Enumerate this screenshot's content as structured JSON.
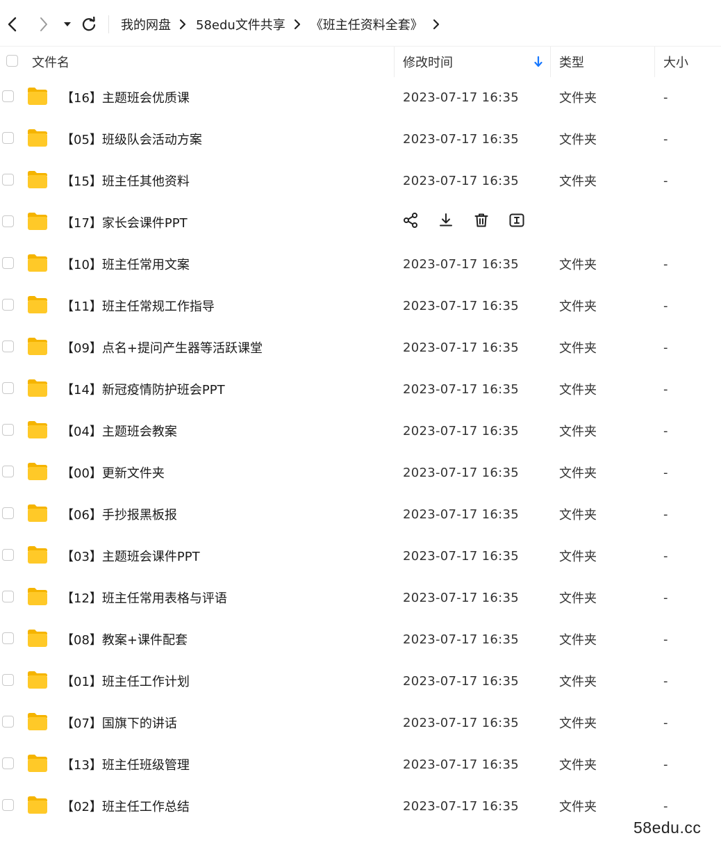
{
  "nav": {
    "breadcrumb": [
      "我的网盘",
      "58edu文件共享",
      "《班主任资料全套》"
    ]
  },
  "table": {
    "columns": {
      "name": "文件名",
      "mtime": "修改时间",
      "type": "类型",
      "size": "大小"
    },
    "rows": [
      {
        "name": "【16】主题班会优质课",
        "mtime": "2023-07-17 16:35",
        "type": "文件夹",
        "size": "-"
      },
      {
        "name": "【05】班级队会活动方案",
        "mtime": "2023-07-17 16:35",
        "type": "文件夹",
        "size": "-"
      },
      {
        "name": "【15】班主任其他资料",
        "mtime": "2023-07-17 16:35",
        "type": "文件夹",
        "size": "-"
      },
      {
        "name": "【17】家长会课件PPT",
        "mtime": "",
        "type": "",
        "size": "",
        "hovered": true
      },
      {
        "name": "【10】班主任常用文案",
        "mtime": "2023-07-17 16:35",
        "type": "文件夹",
        "size": "-"
      },
      {
        "name": "【11】班主任常规工作指导",
        "mtime": "2023-07-17 16:35",
        "type": "文件夹",
        "size": "-"
      },
      {
        "name": "【09】点名+提问产生器等活跃课堂",
        "mtime": "2023-07-17 16:35",
        "type": "文件夹",
        "size": "-"
      },
      {
        "name": "【14】新冠疫情防护班会PPT",
        "mtime": "2023-07-17 16:35",
        "type": "文件夹",
        "size": "-"
      },
      {
        "name": "【04】主题班会教案",
        "mtime": "2023-07-17 16:35",
        "type": "文件夹",
        "size": "-"
      },
      {
        "name": "【00】更新文件夹",
        "mtime": "2023-07-17 16:35",
        "type": "文件夹",
        "size": "-"
      },
      {
        "name": "【06】手抄报黑板报",
        "mtime": "2023-07-17 16:35",
        "type": "文件夹",
        "size": "-"
      },
      {
        "name": "【03】主题班会课件PPT",
        "mtime": "2023-07-17 16:35",
        "type": "文件夹",
        "size": "-"
      },
      {
        "name": "【12】班主任常用表格与评语",
        "mtime": "2023-07-17 16:35",
        "type": "文件夹",
        "size": "-"
      },
      {
        "name": "【08】教案+课件配套",
        "mtime": "2023-07-17 16:35",
        "type": "文件夹",
        "size": "-"
      },
      {
        "name": "【01】班主任工作计划",
        "mtime": "2023-07-17 16:35",
        "type": "文件夹",
        "size": "-"
      },
      {
        "name": "【07】国旗下的讲话",
        "mtime": "2023-07-17 16:35",
        "type": "文件夹",
        "size": "-"
      },
      {
        "name": "【13】班主任班级管理",
        "mtime": "2023-07-17 16:35",
        "type": "文件夹",
        "size": "-"
      },
      {
        "name": "【02】班主任工作总结",
        "mtime": "2023-07-17 16:35",
        "type": "文件夹",
        "size": "-"
      }
    ],
    "hover_actions": [
      "share-icon",
      "download-icon",
      "delete-icon",
      "rename-icon"
    ]
  },
  "watermark": "58edu.cc",
  "colors": {
    "folder": "#FFC928",
    "folder_dark": "#F5B400",
    "accent": "#1677FF"
  }
}
